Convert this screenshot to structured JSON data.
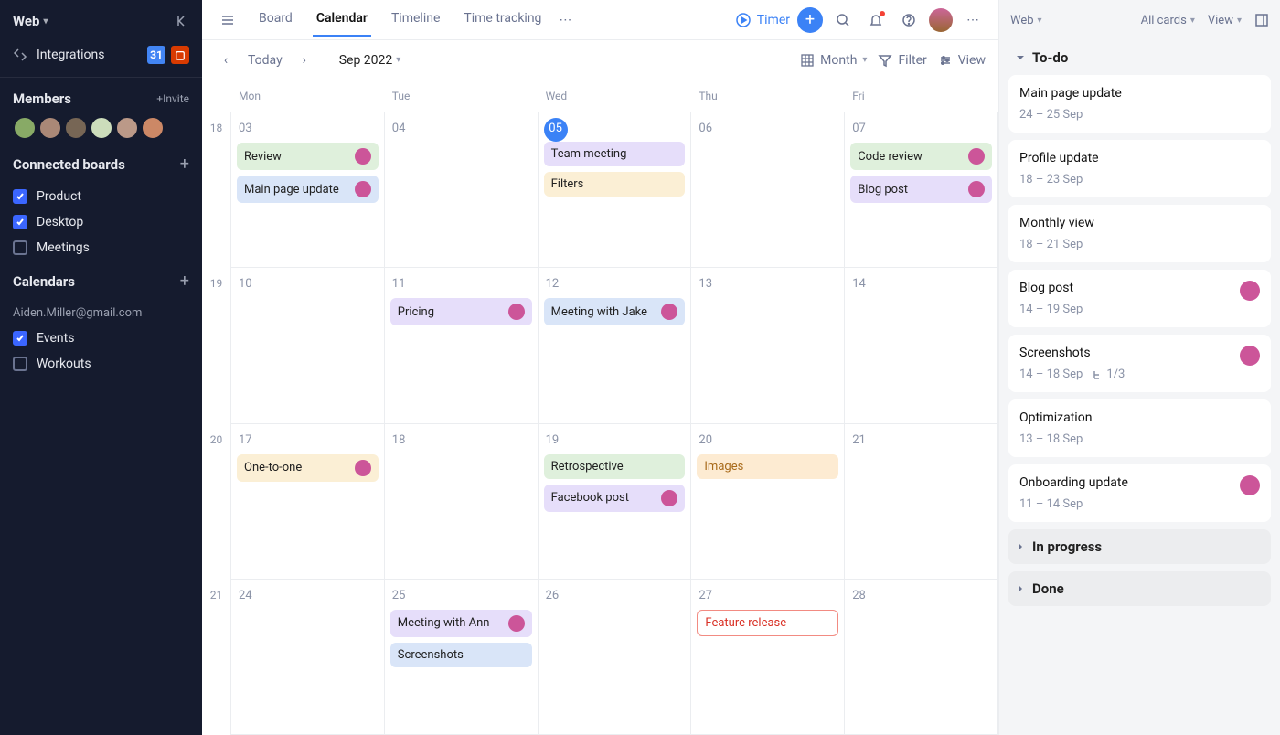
{
  "sidebar": {
    "workspace": "Web",
    "integrations_label": "Integrations",
    "members_label": "Members",
    "invite_label": "+Invite",
    "connected_label": "Connected boards",
    "boards": [
      {
        "label": "Product",
        "checked": true
      },
      {
        "label": "Desktop",
        "checked": true
      },
      {
        "label": "Meetings",
        "checked": false
      }
    ],
    "calendars_label": "Calendars",
    "calendar_account": "Aiden.Miller@gmail.com",
    "calendar_items": [
      {
        "label": "Events",
        "checked": true
      },
      {
        "label": "Workouts",
        "checked": false
      }
    ]
  },
  "topbar": {
    "tabs": [
      "Board",
      "Calendar",
      "Timeline",
      "Time tracking"
    ],
    "active_tab": "Calendar",
    "timer": "Timer"
  },
  "secondbar": {
    "today": "Today",
    "monthlabel": "Sep 2022",
    "period": "Month",
    "filter": "Filter",
    "view": "View"
  },
  "calendar": {
    "days": [
      "Mon",
      "Tue",
      "Wed",
      "Thu",
      "Fri"
    ],
    "weeks": [
      {
        "wk": "18",
        "cells": [
          {
            "d": "03",
            "today": false,
            "cards": [
              {
                "t": "Review",
                "c": "green",
                "av": true
              },
              {
                "t": "Main page update",
                "c": "blue",
                "av": true
              }
            ]
          },
          {
            "d": "04",
            "today": false,
            "cards": []
          },
          {
            "d": "05",
            "today": true,
            "cards": [
              {
                "t": "Team meeting",
                "c": "purple"
              },
              {
                "t": "Filters",
                "c": "yellow"
              }
            ]
          },
          {
            "d": "06",
            "today": false,
            "cards": []
          },
          {
            "d": "07",
            "today": false,
            "cards": [
              {
                "t": "Code review",
                "c": "green",
                "av": true
              },
              {
                "t": "Blog post",
                "c": "purple",
                "av": true
              }
            ]
          }
        ]
      },
      {
        "wk": "19",
        "cells": [
          {
            "d": "10",
            "cards": []
          },
          {
            "d": "11",
            "cards": [
              {
                "t": "Pricing",
                "c": "purple",
                "av": true
              }
            ]
          },
          {
            "d": "12",
            "cards": [
              {
                "t": "Meeting with Jake",
                "c": "blue",
                "av": true
              }
            ]
          },
          {
            "d": "13",
            "cards": []
          },
          {
            "d": "14",
            "cards": []
          }
        ]
      },
      {
        "wk": "20",
        "cells": [
          {
            "d": "17",
            "cards": [
              {
                "t": "One-to-one",
                "c": "yellow",
                "av": true
              }
            ]
          },
          {
            "d": "18",
            "cards": []
          },
          {
            "d": "19",
            "cards": [
              {
                "t": "Retrospective",
                "c": "green"
              },
              {
                "t": "Facebook post",
                "c": "purple",
                "av": true
              }
            ]
          },
          {
            "d": "20",
            "cards": [
              {
                "t": "Images",
                "c": "orange"
              }
            ]
          },
          {
            "d": "21",
            "cards": []
          }
        ]
      },
      {
        "wk": "21",
        "cells": [
          {
            "d": "24",
            "cards": []
          },
          {
            "d": "25",
            "cards": [
              {
                "t": "Meeting with Ann",
                "c": "purple",
                "av": true
              },
              {
                "t": "Screenshots",
                "c": "blue"
              }
            ]
          },
          {
            "d": "26",
            "cards": []
          },
          {
            "d": "27",
            "cards": [
              {
                "t": "Feature release",
                "c": "red"
              }
            ]
          },
          {
            "d": "28",
            "cards": []
          }
        ]
      }
    ]
  },
  "rpanel": {
    "project": "Web",
    "allcards": "All cards",
    "view": "View",
    "groups": {
      "todo": {
        "label": "To-do",
        "open": true,
        "cards": [
          {
            "title": "Main page update",
            "date": "24 – 25 Sep"
          },
          {
            "title": "Profile update",
            "date": "18 – 23 Sep"
          },
          {
            "title": "Monthly view",
            "date": "18 – 21 Sep"
          },
          {
            "title": "Blog post",
            "date": "14 – 19 Sep",
            "av": true
          },
          {
            "title": "Screenshots",
            "date": "14 – 18 Sep",
            "sub": "1/3",
            "av": true
          },
          {
            "title": "Optimization",
            "date": "13 – 18 Sep"
          },
          {
            "title": "Onboarding update",
            "date": "11 – 14 Sep",
            "av": true
          }
        ]
      },
      "inprogress": {
        "label": "In progress",
        "open": false
      },
      "done": {
        "label": "Done",
        "open": false
      }
    }
  }
}
